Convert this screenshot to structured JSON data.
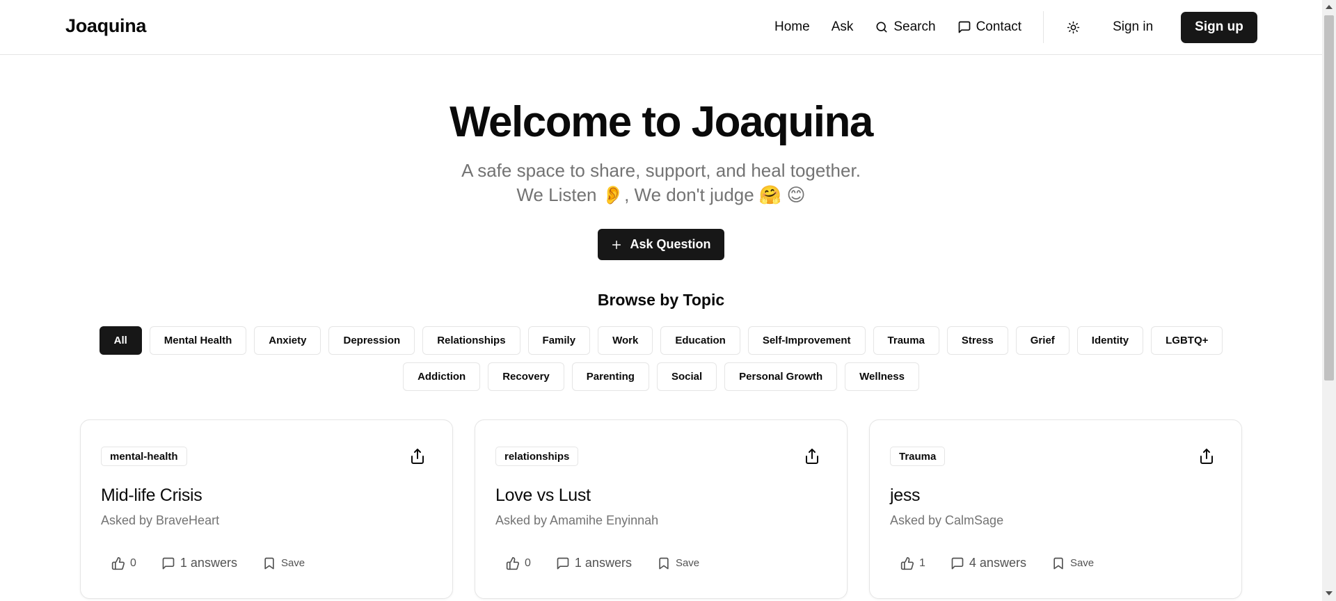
{
  "header": {
    "brand": "Joaquina",
    "nav": {
      "home": "Home",
      "ask": "Ask",
      "search": "Search",
      "contact": "Contact"
    },
    "sign_in": "Sign in",
    "sign_up": "Sign up"
  },
  "hero": {
    "title": "Welcome to Joaquina",
    "subtitle_line1": "A safe space to share, support, and heal together.",
    "subtitle_line2": "We Listen 👂, We don't judge 🤗  😊",
    "ask_button": "Ask Question"
  },
  "topics": {
    "heading": "Browse by Topic",
    "active": "All",
    "row1": [
      "All",
      "Mental Health",
      "Anxiety",
      "Depression",
      "Relationships",
      "Family",
      "Work",
      "Education",
      "Self-Improvement",
      "Trauma",
      "Stress",
      "Grief",
      "Identity",
      "LGBTQ+"
    ],
    "row2": [
      "Addiction",
      "Recovery",
      "Parenting",
      "Social",
      "Personal Growth",
      "Wellness"
    ]
  },
  "questions": [
    {
      "tag": "mental-health",
      "title": "Mid-life Crisis",
      "author": "Asked by BraveHeart",
      "likes": "0",
      "answers": "1 answers",
      "save": "Save"
    },
    {
      "tag": "relationships",
      "title": "Love vs Lust",
      "author": "Asked by Amamihe Enyinnah",
      "likes": "0",
      "answers": "1 answers",
      "save": "Save"
    },
    {
      "tag": "Trauma",
      "title": "jess",
      "author": "Asked by CalmSage",
      "likes": "1",
      "answers": "4 answers",
      "save": "Save"
    }
  ],
  "icons": {
    "search": "search-icon",
    "contact": "message-square-icon",
    "theme": "sun-icon",
    "plus": "plus-icon",
    "share": "share-icon",
    "like": "thumbs-up-icon",
    "answers": "message-square-icon",
    "save": "bookmark-icon"
  }
}
